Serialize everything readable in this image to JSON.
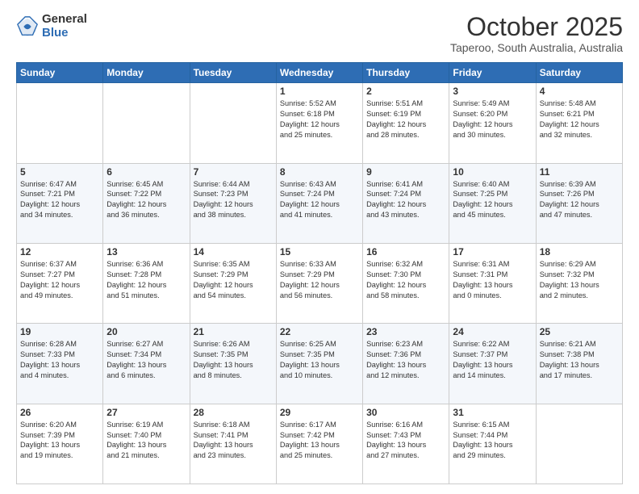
{
  "logo": {
    "general": "General",
    "blue": "Blue"
  },
  "header": {
    "month": "October 2025",
    "location": "Taperoo, South Australia, Australia"
  },
  "weekdays": [
    "Sunday",
    "Monday",
    "Tuesday",
    "Wednesday",
    "Thursday",
    "Friday",
    "Saturday"
  ],
  "weeks": [
    [
      {
        "day": "",
        "info": ""
      },
      {
        "day": "",
        "info": ""
      },
      {
        "day": "",
        "info": ""
      },
      {
        "day": "1",
        "info": "Sunrise: 5:52 AM\nSunset: 6:18 PM\nDaylight: 12 hours\nand 25 minutes."
      },
      {
        "day": "2",
        "info": "Sunrise: 5:51 AM\nSunset: 6:19 PM\nDaylight: 12 hours\nand 28 minutes."
      },
      {
        "day": "3",
        "info": "Sunrise: 5:49 AM\nSunset: 6:20 PM\nDaylight: 12 hours\nand 30 minutes."
      },
      {
        "day": "4",
        "info": "Sunrise: 5:48 AM\nSunset: 6:21 PM\nDaylight: 12 hours\nand 32 minutes."
      }
    ],
    [
      {
        "day": "5",
        "info": "Sunrise: 6:47 AM\nSunset: 7:21 PM\nDaylight: 12 hours\nand 34 minutes."
      },
      {
        "day": "6",
        "info": "Sunrise: 6:45 AM\nSunset: 7:22 PM\nDaylight: 12 hours\nand 36 minutes."
      },
      {
        "day": "7",
        "info": "Sunrise: 6:44 AM\nSunset: 7:23 PM\nDaylight: 12 hours\nand 38 minutes."
      },
      {
        "day": "8",
        "info": "Sunrise: 6:43 AM\nSunset: 7:24 PM\nDaylight: 12 hours\nand 41 minutes."
      },
      {
        "day": "9",
        "info": "Sunrise: 6:41 AM\nSunset: 7:24 PM\nDaylight: 12 hours\nand 43 minutes."
      },
      {
        "day": "10",
        "info": "Sunrise: 6:40 AM\nSunset: 7:25 PM\nDaylight: 12 hours\nand 45 minutes."
      },
      {
        "day": "11",
        "info": "Sunrise: 6:39 AM\nSunset: 7:26 PM\nDaylight: 12 hours\nand 47 minutes."
      }
    ],
    [
      {
        "day": "12",
        "info": "Sunrise: 6:37 AM\nSunset: 7:27 PM\nDaylight: 12 hours\nand 49 minutes."
      },
      {
        "day": "13",
        "info": "Sunrise: 6:36 AM\nSunset: 7:28 PM\nDaylight: 12 hours\nand 51 minutes."
      },
      {
        "day": "14",
        "info": "Sunrise: 6:35 AM\nSunset: 7:29 PM\nDaylight: 12 hours\nand 54 minutes."
      },
      {
        "day": "15",
        "info": "Sunrise: 6:33 AM\nSunset: 7:29 PM\nDaylight: 12 hours\nand 56 minutes."
      },
      {
        "day": "16",
        "info": "Sunrise: 6:32 AM\nSunset: 7:30 PM\nDaylight: 12 hours\nand 58 minutes."
      },
      {
        "day": "17",
        "info": "Sunrise: 6:31 AM\nSunset: 7:31 PM\nDaylight: 13 hours\nand 0 minutes."
      },
      {
        "day": "18",
        "info": "Sunrise: 6:29 AM\nSunset: 7:32 PM\nDaylight: 13 hours\nand 2 minutes."
      }
    ],
    [
      {
        "day": "19",
        "info": "Sunrise: 6:28 AM\nSunset: 7:33 PM\nDaylight: 13 hours\nand 4 minutes."
      },
      {
        "day": "20",
        "info": "Sunrise: 6:27 AM\nSunset: 7:34 PM\nDaylight: 13 hours\nand 6 minutes."
      },
      {
        "day": "21",
        "info": "Sunrise: 6:26 AM\nSunset: 7:35 PM\nDaylight: 13 hours\nand 8 minutes."
      },
      {
        "day": "22",
        "info": "Sunrise: 6:25 AM\nSunset: 7:35 PM\nDaylight: 13 hours\nand 10 minutes."
      },
      {
        "day": "23",
        "info": "Sunrise: 6:23 AM\nSunset: 7:36 PM\nDaylight: 13 hours\nand 12 minutes."
      },
      {
        "day": "24",
        "info": "Sunrise: 6:22 AM\nSunset: 7:37 PM\nDaylight: 13 hours\nand 14 minutes."
      },
      {
        "day": "25",
        "info": "Sunrise: 6:21 AM\nSunset: 7:38 PM\nDaylight: 13 hours\nand 17 minutes."
      }
    ],
    [
      {
        "day": "26",
        "info": "Sunrise: 6:20 AM\nSunset: 7:39 PM\nDaylight: 13 hours\nand 19 minutes."
      },
      {
        "day": "27",
        "info": "Sunrise: 6:19 AM\nSunset: 7:40 PM\nDaylight: 13 hours\nand 21 minutes."
      },
      {
        "day": "28",
        "info": "Sunrise: 6:18 AM\nSunset: 7:41 PM\nDaylight: 13 hours\nand 23 minutes."
      },
      {
        "day": "29",
        "info": "Sunrise: 6:17 AM\nSunset: 7:42 PM\nDaylight: 13 hours\nand 25 minutes."
      },
      {
        "day": "30",
        "info": "Sunrise: 6:16 AM\nSunset: 7:43 PM\nDaylight: 13 hours\nand 27 minutes."
      },
      {
        "day": "31",
        "info": "Sunrise: 6:15 AM\nSunset: 7:44 PM\nDaylight: 13 hours\nand 29 minutes."
      },
      {
        "day": "",
        "info": ""
      }
    ]
  ]
}
